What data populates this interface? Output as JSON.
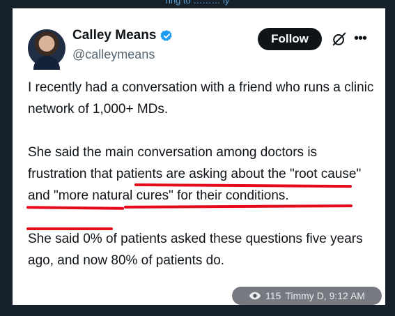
{
  "header": {
    "sliver_text": "ring to ……… ly"
  },
  "post": {
    "author_name": "Calley Means",
    "handle": "@calleymeans",
    "follow_label": "Follow",
    "more_label": "•••",
    "paragraph1": "I recently had a conversation with a friend who runs a clinic network of 1,000+ MDs.",
    "paragraph2_start": "She said the main conversation among doctors is frustration that ",
    "paragraph2_highlight": "patients are asking about the \"root cause\" and \"more natural cures\" for their conditions",
    "paragraph2_end": ".",
    "paragraph3": "She said 0% of patients asked these questions five years ago, and now 80% of patients do."
  },
  "overlay": {
    "views": "115",
    "author_time": "Timmy D, 9:12 AM"
  },
  "colors": {
    "background": "#17212b",
    "card": "#ffffff",
    "verified_badge": "#1d9bf0",
    "annotation_underline": "#e30b1c",
    "follow_button": "#0f1419"
  },
  "icons": [
    "verified-badge-icon",
    "grok-icon",
    "more-options-icon",
    "eye-icon"
  ]
}
